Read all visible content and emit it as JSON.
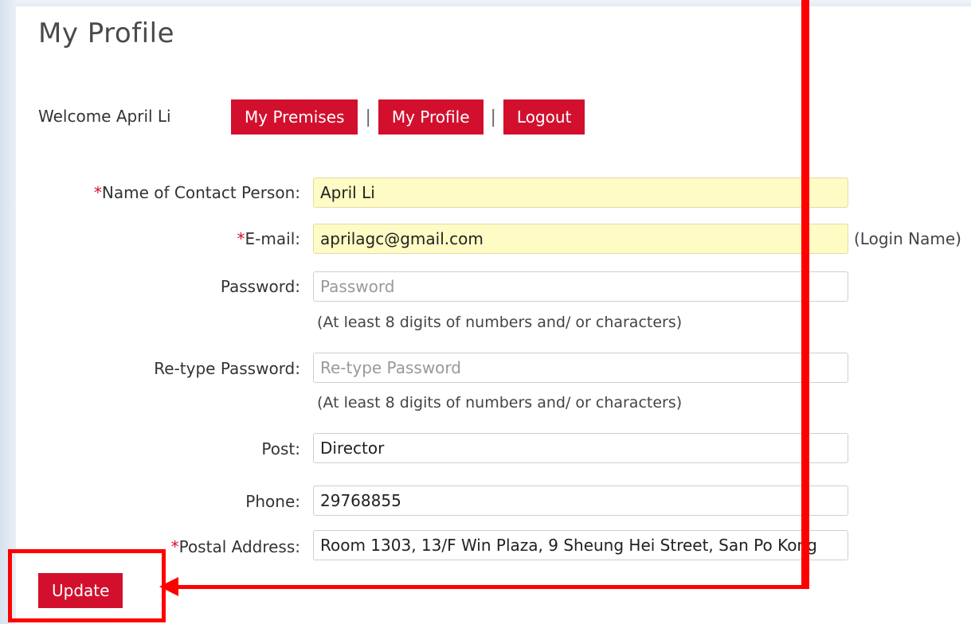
{
  "page": {
    "title": "My Profile"
  },
  "header": {
    "welcome_text": "Welcome April Li",
    "nav": {
      "my_premises": "My Premises",
      "my_profile": "My Profile",
      "logout": "Logout",
      "separator": "|"
    }
  },
  "form": {
    "required_marker": "*",
    "contact_person": {
      "label": "Name of Contact Person:",
      "value": "April Li"
    },
    "email": {
      "label": "E-mail:",
      "value": "aprilagc@gmail.com",
      "note": "(Login Name)"
    },
    "password": {
      "label": "Password:",
      "placeholder": "Password",
      "hint": "(At least 8 digits of numbers and/ or characters)"
    },
    "retype_password": {
      "label": "Re-type Password:",
      "placeholder": "Re-type Password",
      "hint": "(At least 8 digits of numbers and/ or characters)"
    },
    "post": {
      "label": "Post:",
      "value": "Director"
    },
    "phone": {
      "label": "Phone:",
      "value": "29768855"
    },
    "postal_address": {
      "label": "Postal Address:",
      "value": "Room 1303, 13/F Win Plaza, 9 Sheung Hei Street, San Po Kong"
    },
    "update_label": "Update"
  },
  "colors": {
    "accent": "#d2102e",
    "autofill_bg": "#fefcc4",
    "annotation": "#ff0000"
  }
}
